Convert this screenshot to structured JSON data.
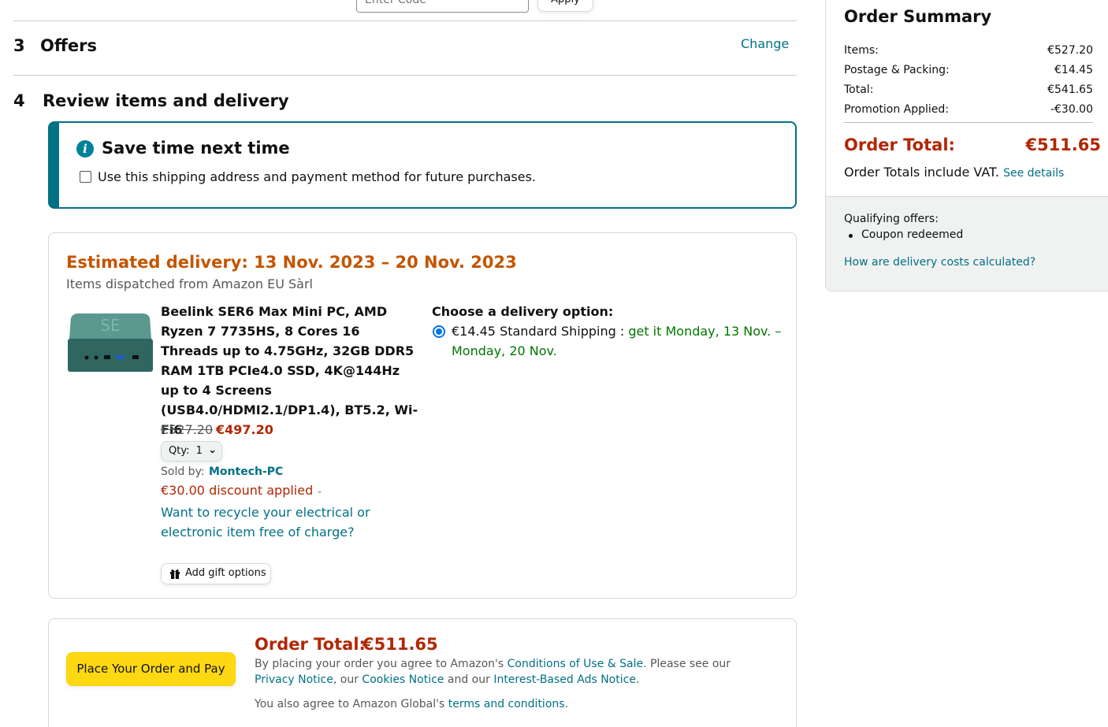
{
  "promo": {
    "placeholder": "Enter Code",
    "apply_label": "Apply"
  },
  "steps": [
    {
      "num": "3",
      "title": "Offers",
      "change_label": "Change"
    },
    {
      "num": "4",
      "title": "Review items and delivery"
    }
  ],
  "save_time": {
    "title": "Save time next time",
    "checkbox_label": "Use this shipping address and payment method for future purchases."
  },
  "delivery": {
    "estimated": "Estimated delivery: 13 Nov. 2023 – 20 Nov. 2023",
    "dispatched": "Items dispatched from Amazon EU Sàrl",
    "product": {
      "title": "Beelink SER6 Max Mini PC, AMD Ryzen 7 7735HS, 8 Cores 16 Threads up to 4.75GHz, 32GB DDR5 RAM 1TB PCIe4.0 SSD, 4K@144Hz up to 4 Screens (USB4.0/HDMI2.1/DP1.4), BT5.2, Wi-Fi6",
      "old_price": "€527.20",
      "new_price": "€497.20",
      "qty_label": "Qty:",
      "qty_value": "1",
      "sold_by_label": "Sold by:",
      "sold_by_name": "Montech-PC",
      "discount": "€30.00 discount applied",
      "recycle_link": "Want to recycle your electrical or electronic item free of charge?",
      "gift_label": "Add gift options"
    },
    "options": {
      "title": "Choose a delivery option:",
      "price_label": "€14.45 Standard Shipping",
      "separator": " : ",
      "date_range": "get it Monday, 13 Nov. – Monday, 20 Nov."
    }
  },
  "place_order": {
    "button_label": "Place Your Order and Pay",
    "total_label": "Order Total:",
    "total_value": "€511.65",
    "legal_prefix": "By placing your order you agree to Amazon's ",
    "conditions_link": "Conditions of Use & Sale",
    "legal_mid": ". Please see our ",
    "privacy_link": "Privacy Notice",
    "legal_mid2": ", our ",
    "cookies_link": "Cookies Notice",
    "legal_mid3": " and our ",
    "ads_link": "Interest-Based Ads Notice",
    "legal_end": ".",
    "global_prefix": "You also agree to Amazon Global's ",
    "terms_link": "terms and conditions",
    "global_end": "."
  },
  "summary": {
    "title": "Order Summary",
    "rows": [
      {
        "label": "Items:",
        "value": "€527.20"
      },
      {
        "label": "Postage & Packing:",
        "value": "€14.45"
      },
      {
        "label": "Total:",
        "value": "€541.65"
      },
      {
        "label": "Promotion Applied:",
        "value": "-€30.00"
      }
    ],
    "order_total_label": "Order Total:",
    "order_total_value": "€511.65",
    "vat_text": "Order Totals include VAT. ",
    "vat_link": "See details",
    "qualifying_title": "Qualifying offers:",
    "qualifying_items": [
      "Coupon redeemed"
    ],
    "delivery_costs_link": "How are delivery costs calculated?"
  },
  "colors": {
    "accent": "#007185",
    "price_red": "#b12704",
    "delivery_orange": "#c45500",
    "ship_green": "#007600",
    "button_yellow": "#ffd814"
  },
  "icons": [
    "info-icon",
    "chevron-down-icon",
    "gift-icon",
    "radio-selected-icon"
  ]
}
